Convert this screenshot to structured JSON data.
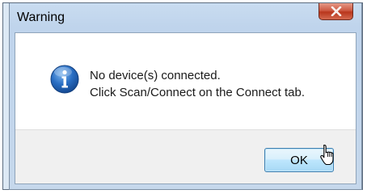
{
  "dialog": {
    "title": "Warning",
    "icon": "info-icon",
    "message_line1": "No device(s) connected.",
    "message_line2": "Click Scan/Connect on the Connect tab.",
    "ok_label": "OK"
  },
  "colors": {
    "close_button": "#cd5a43",
    "info_icon": "#1f63b8",
    "ok_button_border": "#3c7fb1"
  }
}
